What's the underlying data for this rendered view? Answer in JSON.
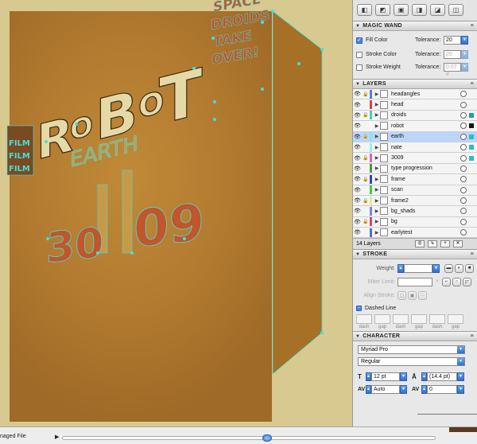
{
  "canvas": {
    "poster_text": {
      "robot": "ROBOT",
      "robot_letters": [
        "R",
        "O",
        "B",
        "O",
        "T"
      ],
      "earth": "EARTH",
      "num_left": "30",
      "num_right": "09",
      "side_lines": [
        "SPACE",
        "DROIDS",
        "TAKE",
        "OVER!"
      ],
      "left_lines": [
        "FILM",
        "FILM",
        "FILM"
      ]
    },
    "colors": {
      "artboard": "#b27a30",
      "pasteboard": "#d8c990",
      "selection": "#40e0e0",
      "digits": "#c2552a",
      "letters": "#e6d9a8"
    }
  },
  "tools": [
    "pathfinder-unite-icon",
    "pathfinder-minus-icon",
    "pathfinder-intersect-icon",
    "pathfinder-exclude-icon",
    "pathfinder-divide-icon",
    "pathfinder-trim-icon"
  ],
  "magic_wand": {
    "title": "MAGIC WAND",
    "fill_color_label": "Fill Color",
    "fill_checked": true,
    "tolerance_label": "Tolerance:",
    "fill_tolerance": "20",
    "stroke_color_label": "Stroke Color",
    "stroke_tolerance": "20",
    "stroke_weight_label": "Stroke Weight",
    "weight_tolerance": "0.07 ir"
  },
  "layers": {
    "title": "LAYERS",
    "items": [
      {
        "name": "headangles",
        "color": "#4a7df0",
        "sel": false,
        "sq": ""
      },
      {
        "name": "head",
        "color": "#e04040",
        "sel": false,
        "sq": ""
      },
      {
        "name": "droids",
        "color": "#40d0c0",
        "sel": false,
        "sq": "#20a0a0"
      },
      {
        "name": "robot",
        "color": "#ffffff",
        "sel": false,
        "sq": "#111111"
      },
      {
        "name": "earth",
        "color": "#7fe8f4",
        "sel": true,
        "sq": "#20c0d0"
      },
      {
        "name": "nate",
        "color": "#90f0f8",
        "sel": false,
        "sq": "#20c0d0"
      },
      {
        "name": "3009",
        "color": "#e060d0",
        "sel": false,
        "sq": "#20c0d0"
      },
      {
        "name": "type progression",
        "color": "#40a040",
        "sel": false,
        "sq": ""
      },
      {
        "name": "frame",
        "color": "#3040d0",
        "sel": false,
        "sq": ""
      },
      {
        "name": "scan",
        "color": "#40d040",
        "sel": false,
        "sq": ""
      },
      {
        "name": "frame2",
        "color": "#e8e8a0",
        "sel": false,
        "sq": ""
      },
      {
        "name": "bg_shads",
        "color": "#8080e0",
        "sel": false,
        "sq": ""
      },
      {
        "name": "bg",
        "color": "#e04070",
        "sel": false,
        "sq": ""
      },
      {
        "name": "earlytest",
        "color": "#4070e0",
        "sel": false,
        "sq": ""
      }
    ],
    "count_label": "14 Layers"
  },
  "stroke": {
    "title": "STROKE",
    "weight_label": "Weight:",
    "miter_label": "Miter Limit:",
    "align_label": "Align Stroke:",
    "dashed_label": "Dashed Line",
    "dash_labels": [
      "dash",
      "gap",
      "dash",
      "gap",
      "dash",
      "gap"
    ]
  },
  "character": {
    "title": "CHARACTER",
    "font": "Myriad Pro",
    "style": "Regular",
    "size": "12 pt",
    "leading": "(14.4 pt)",
    "kerning": "Auto",
    "tracking": "0"
  },
  "status": {
    "label": "naged File"
  }
}
